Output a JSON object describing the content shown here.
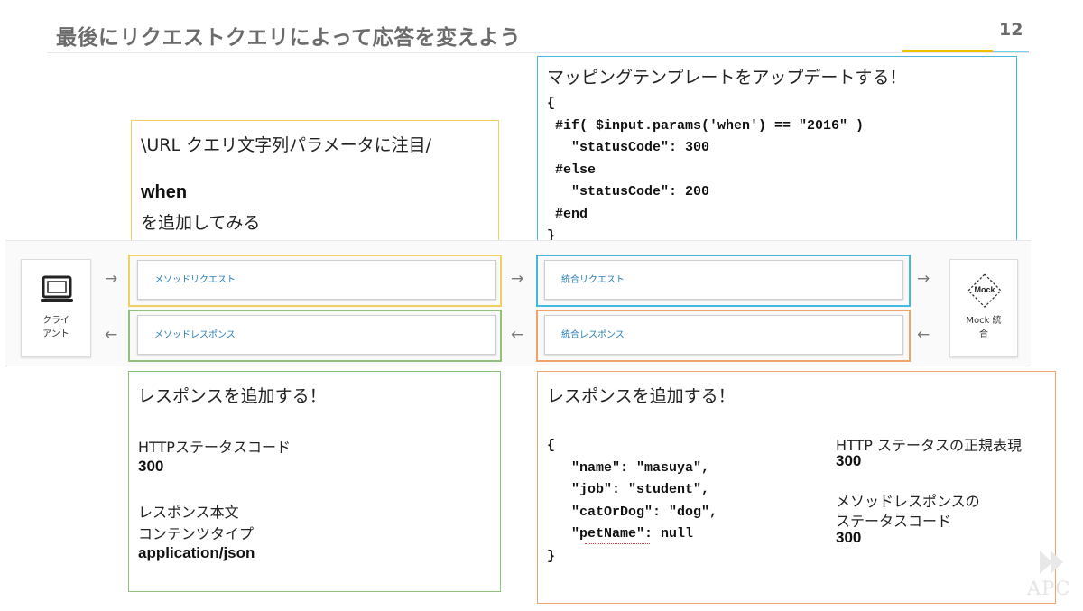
{
  "slide": {
    "title": "最後にリクエストクエリによって応答を変えよう",
    "page_number": "12"
  },
  "query_note": {
    "line1": "\\URL クエリ文字列パラメータに注目/",
    "keyword": "when",
    "line3": "を追加してみる"
  },
  "mapping_note": {
    "heading": "マッピングテンプレートをアップデートする！",
    "code": [
      "{",
      " #if( $input.params('when') == \"2016\" )",
      "   \"statusCode\": 300",
      " #else",
      "   \"statusCode\": 200",
      " #end",
      "}"
    ]
  },
  "diagram": {
    "client_label_line1": "クライ",
    "client_label_line2": "アント",
    "method_request": "メソッドリクエスト",
    "method_response": "メソッドレスポンス",
    "integration_request": "統合リクエスト",
    "integration_response": "統合レスポンス",
    "mock_badge": "Mock",
    "mock_label_line1": "Mock 統",
    "mock_label_line2": "合",
    "arrow_right": "→",
    "arrow_left": "←",
    "colors": {
      "method_request_border": "#f0d060",
      "method_response_border": "#8fc27a",
      "integration_request_border": "#45b9e0",
      "integration_response_border": "#f0a36a"
    }
  },
  "method_response_note": {
    "heading": "レスポンスを追加する！",
    "status_label": "HTTPステータスコード",
    "status_value": "300",
    "body_label_line1": "レスポンス本文",
    "body_label_line2": "コンテンツタイプ",
    "content_type": "application/json"
  },
  "integration_response_note": {
    "heading": "レスポンスを追加する！",
    "code": [
      "{",
      "   \"name\": \"masuya\",",
      "   \"job\": \"student\",",
      "   \"catOrDog\": \"dog\",",
      "   \"petName\": null",
      "}"
    ],
    "regex_label": "HTTP ステータスの正規表現",
    "regex_value": "300",
    "method_status_label_line1": "メソッドレスポンスの",
    "method_status_label_line2": "ステータスコード",
    "method_status_value": "300"
  },
  "watermark": {
    "text": "APC",
    "icon": "play-icon"
  }
}
